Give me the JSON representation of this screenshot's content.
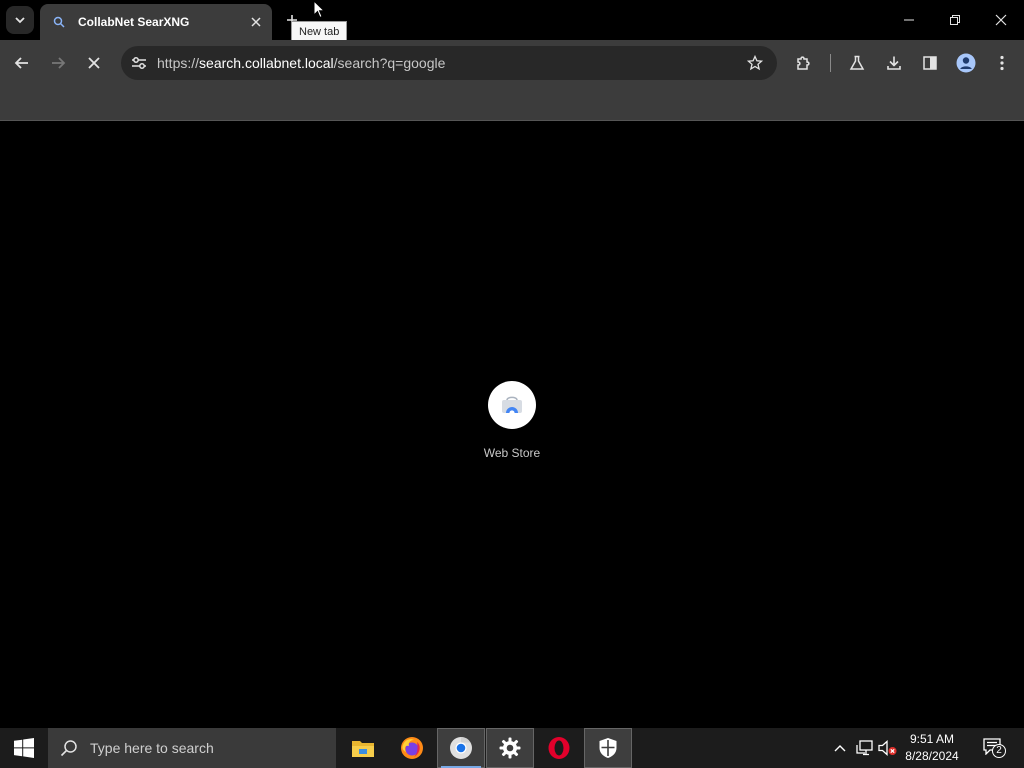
{
  "browser": {
    "tab": {
      "title": "CollabNet SearXNG"
    },
    "new_tab_tooltip": "New tab",
    "address": {
      "scheme": "https://",
      "host": "search.collabnet.local",
      "path": "/search?q=google"
    }
  },
  "content": {
    "shortcut": {
      "label": "Web Store"
    }
  },
  "taskbar": {
    "search_placeholder": "Type here to search",
    "clock": {
      "time": "9:51 AM",
      "date": "8/28/2024"
    },
    "notification_count": "2"
  }
}
